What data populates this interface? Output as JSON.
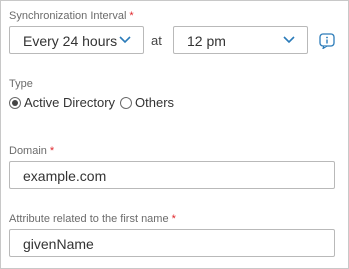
{
  "sync": {
    "label": "Synchronization Interval",
    "required": "*",
    "interval_value": "Every 24 hours",
    "at_label": "at",
    "time_value": "12 pm",
    "info_icon": "info-icon"
  },
  "type": {
    "label": "Type",
    "options": [
      {
        "label": "Active Directory",
        "selected": true
      },
      {
        "label": "Others",
        "selected": false
      }
    ]
  },
  "domain": {
    "label": "Domain",
    "required": "*",
    "value": "example.com"
  },
  "first_name_attr": {
    "label": "Attribute related to the first name",
    "required": "*",
    "value": "givenName"
  },
  "colors": {
    "accent": "#2b7bb9",
    "required": "#e0262b",
    "border": "#b9b9b9"
  }
}
